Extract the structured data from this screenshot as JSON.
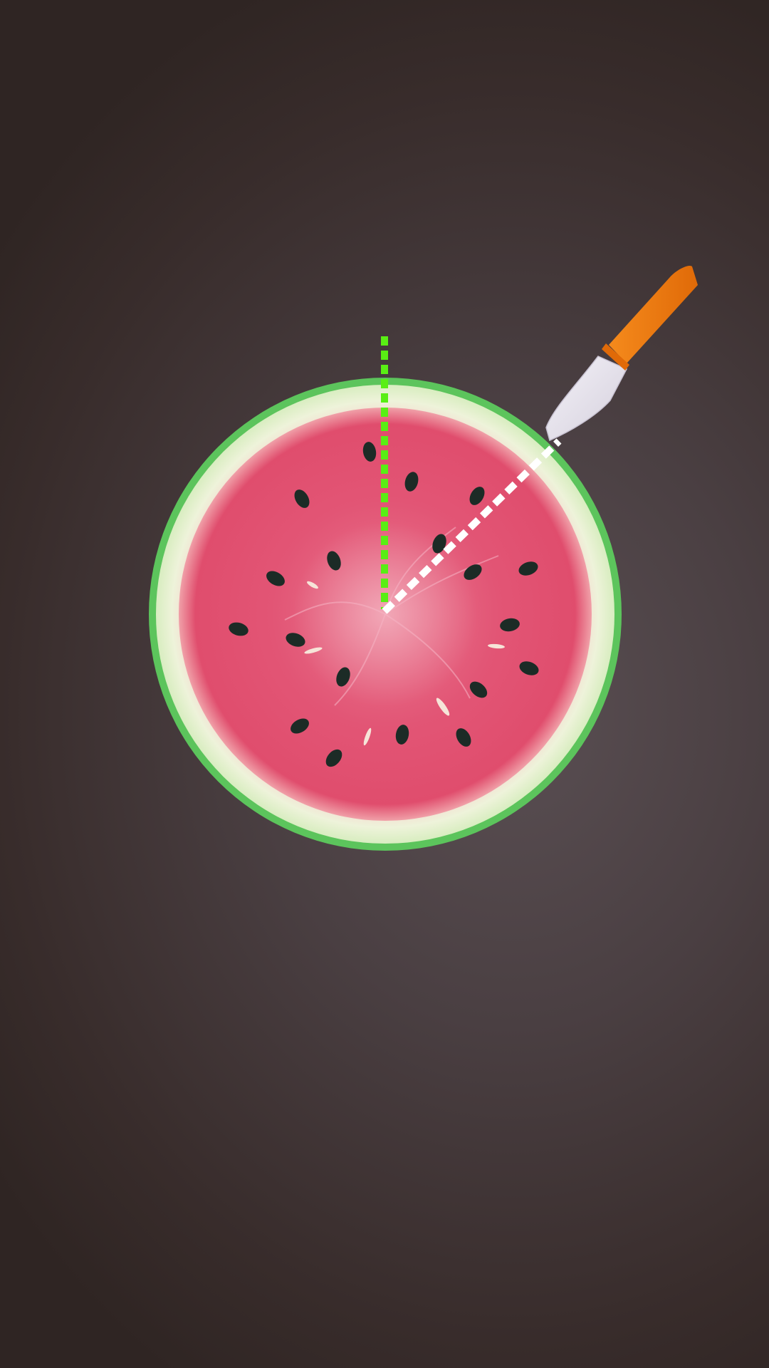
{
  "scene": {
    "background_top": "#382c2b",
    "background_glow": "#5a4f53",
    "fruit": "watermelon-slice",
    "rind_color": "#5cc45c",
    "pith_color": "#e6f2d2",
    "flesh_color": "#e0506e",
    "seed_color": "#1c2b26"
  },
  "guides": {
    "target_line_color": "#59ee14",
    "cut_line_color": "#ffffff"
  },
  "knife": {
    "icon": "knife-icon",
    "handle_color": "#f07a10",
    "blade_color": "#ebe6f0"
  }
}
